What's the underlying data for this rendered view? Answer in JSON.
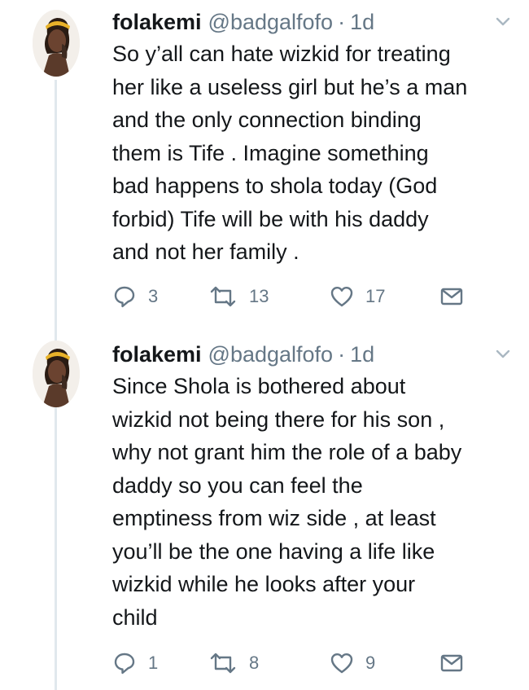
{
  "tweets": [
    {
      "name": "folakemi",
      "handle": "@badgalfofo",
      "separator": "·",
      "time": "1d",
      "text": "So y’all can hate wizkid for treating\nher like a useless girl but he’s a man\nand the only connection binding\nthem is Tife . Imagine something\nbad happens to shola today (God\nforbid) Tife will be with his daddy\nand not her family .",
      "replies": "3",
      "retweets": "13",
      "likes": "17"
    },
    {
      "name": "folakemi",
      "handle": "@badgalfofo",
      "separator": "·",
      "time": "1d",
      "text": "Since Shola is bothered about\nwizkid not being there for his son ,\nwhy not grant him the role of a baby\ndaddy so you can feel the\nemptiness from wiz side , at least\nyou’ll be the one having a life like\nwizkid while he looks after your\nchild",
      "replies": "1",
      "retweets": "8",
      "likes": "9"
    }
  ],
  "colors": {
    "text": "#14171a",
    "secondary": "#657786",
    "thread_line": "#e1e8ed"
  },
  "icons": {
    "reply": "reply-icon",
    "retweet": "retweet-icon",
    "like": "heart-icon",
    "dm": "envelope-icon",
    "menu": "chevron-down-icon"
  }
}
